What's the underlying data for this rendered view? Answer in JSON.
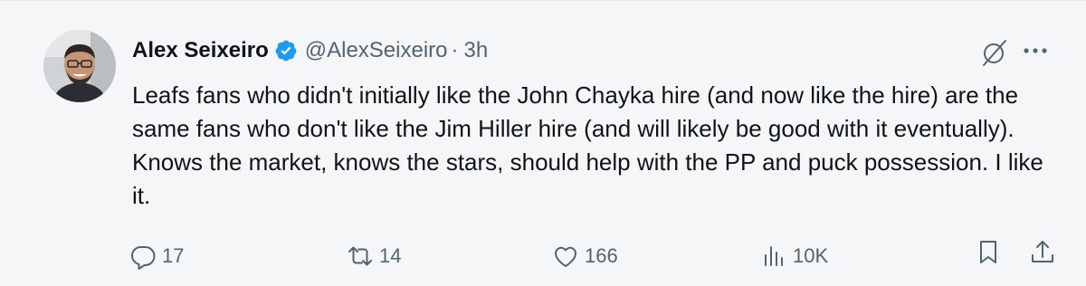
{
  "author": {
    "name": "Alex Seixeiro",
    "handle": "@AlexSeixeiro",
    "separator": "·",
    "time": "3h",
    "verified": true,
    "verified_color": "#1d9bf0"
  },
  "tweet": {
    "text": "Leafs fans who didn't initially like the John Chayka hire (and now like the hire) are the same fans who don't like the Jim Hiller hire (and will likely be good with it eventually). Knows the market, knows the stars, should help with the PP and puck possession. I like it."
  },
  "metrics": {
    "replies": "17",
    "retweets": "14",
    "likes": "166",
    "views": "10K"
  },
  "colors": {
    "text": "#0f1419",
    "secondary": "#536471",
    "background": "#f5f6f7"
  },
  "icons": [
    "grok-icon",
    "more-icon",
    "reply-icon",
    "retweet-icon",
    "like-icon",
    "views-icon",
    "bookmark-icon",
    "share-icon",
    "verified-badge-icon"
  ]
}
